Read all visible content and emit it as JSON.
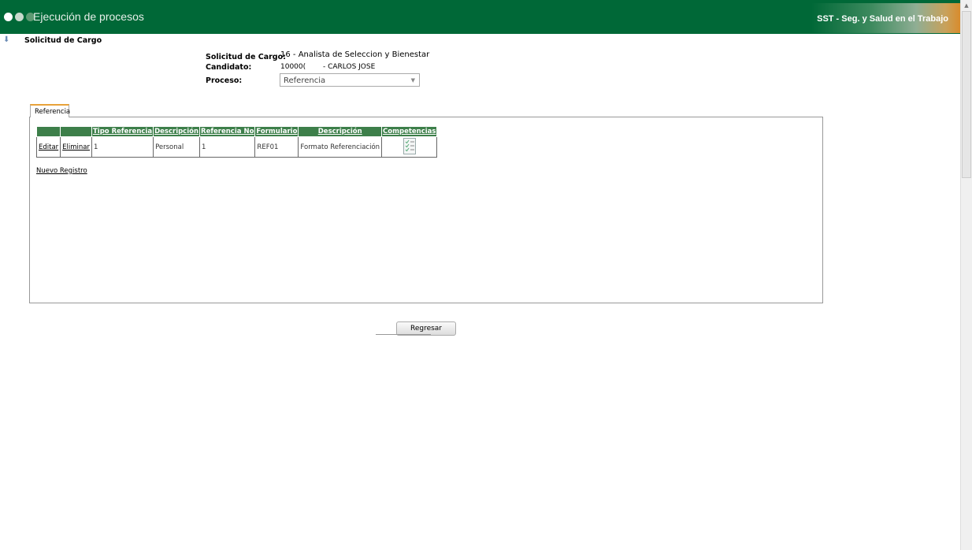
{
  "header": {
    "title": "Ejecución de procesos",
    "brand": "SST - Seg. y Salud en el Trabajo",
    "dots": [
      "#ffffff",
      "#c8d9cc",
      "#5e9a73"
    ]
  },
  "section": {
    "title": "Solicitud de Cargo"
  },
  "form": {
    "solicitud_label": "Solicitud de Cargo:",
    "solicitud_value": "16 - Analista de Seleccion y Bienestar",
    "candidato_label": "Candidato:",
    "candidato_id": "10000(",
    "candidato_name": "- CARLOS JOSE",
    "proceso_label": "Proceso:",
    "proceso_value": "Referencia"
  },
  "tab": {
    "label": "Referencia"
  },
  "table": {
    "headers": [
      "",
      "",
      "Tipo Referencia",
      "Descripción",
      "Referencia No",
      "Formulario",
      "Descripción",
      "Competencias"
    ],
    "rows": [
      {
        "edit": "Editar",
        "delete": "Eliminar",
        "tipo": "1",
        "descripcion": "Personal",
        "referencia_no": "1",
        "formulario": "REF01",
        "descripcion2": "Formato Referenciación",
        "competencias_icon": "checklist-icon"
      }
    ]
  },
  "new_record": "Nuevo Registro",
  "back_button": "Regresar"
}
